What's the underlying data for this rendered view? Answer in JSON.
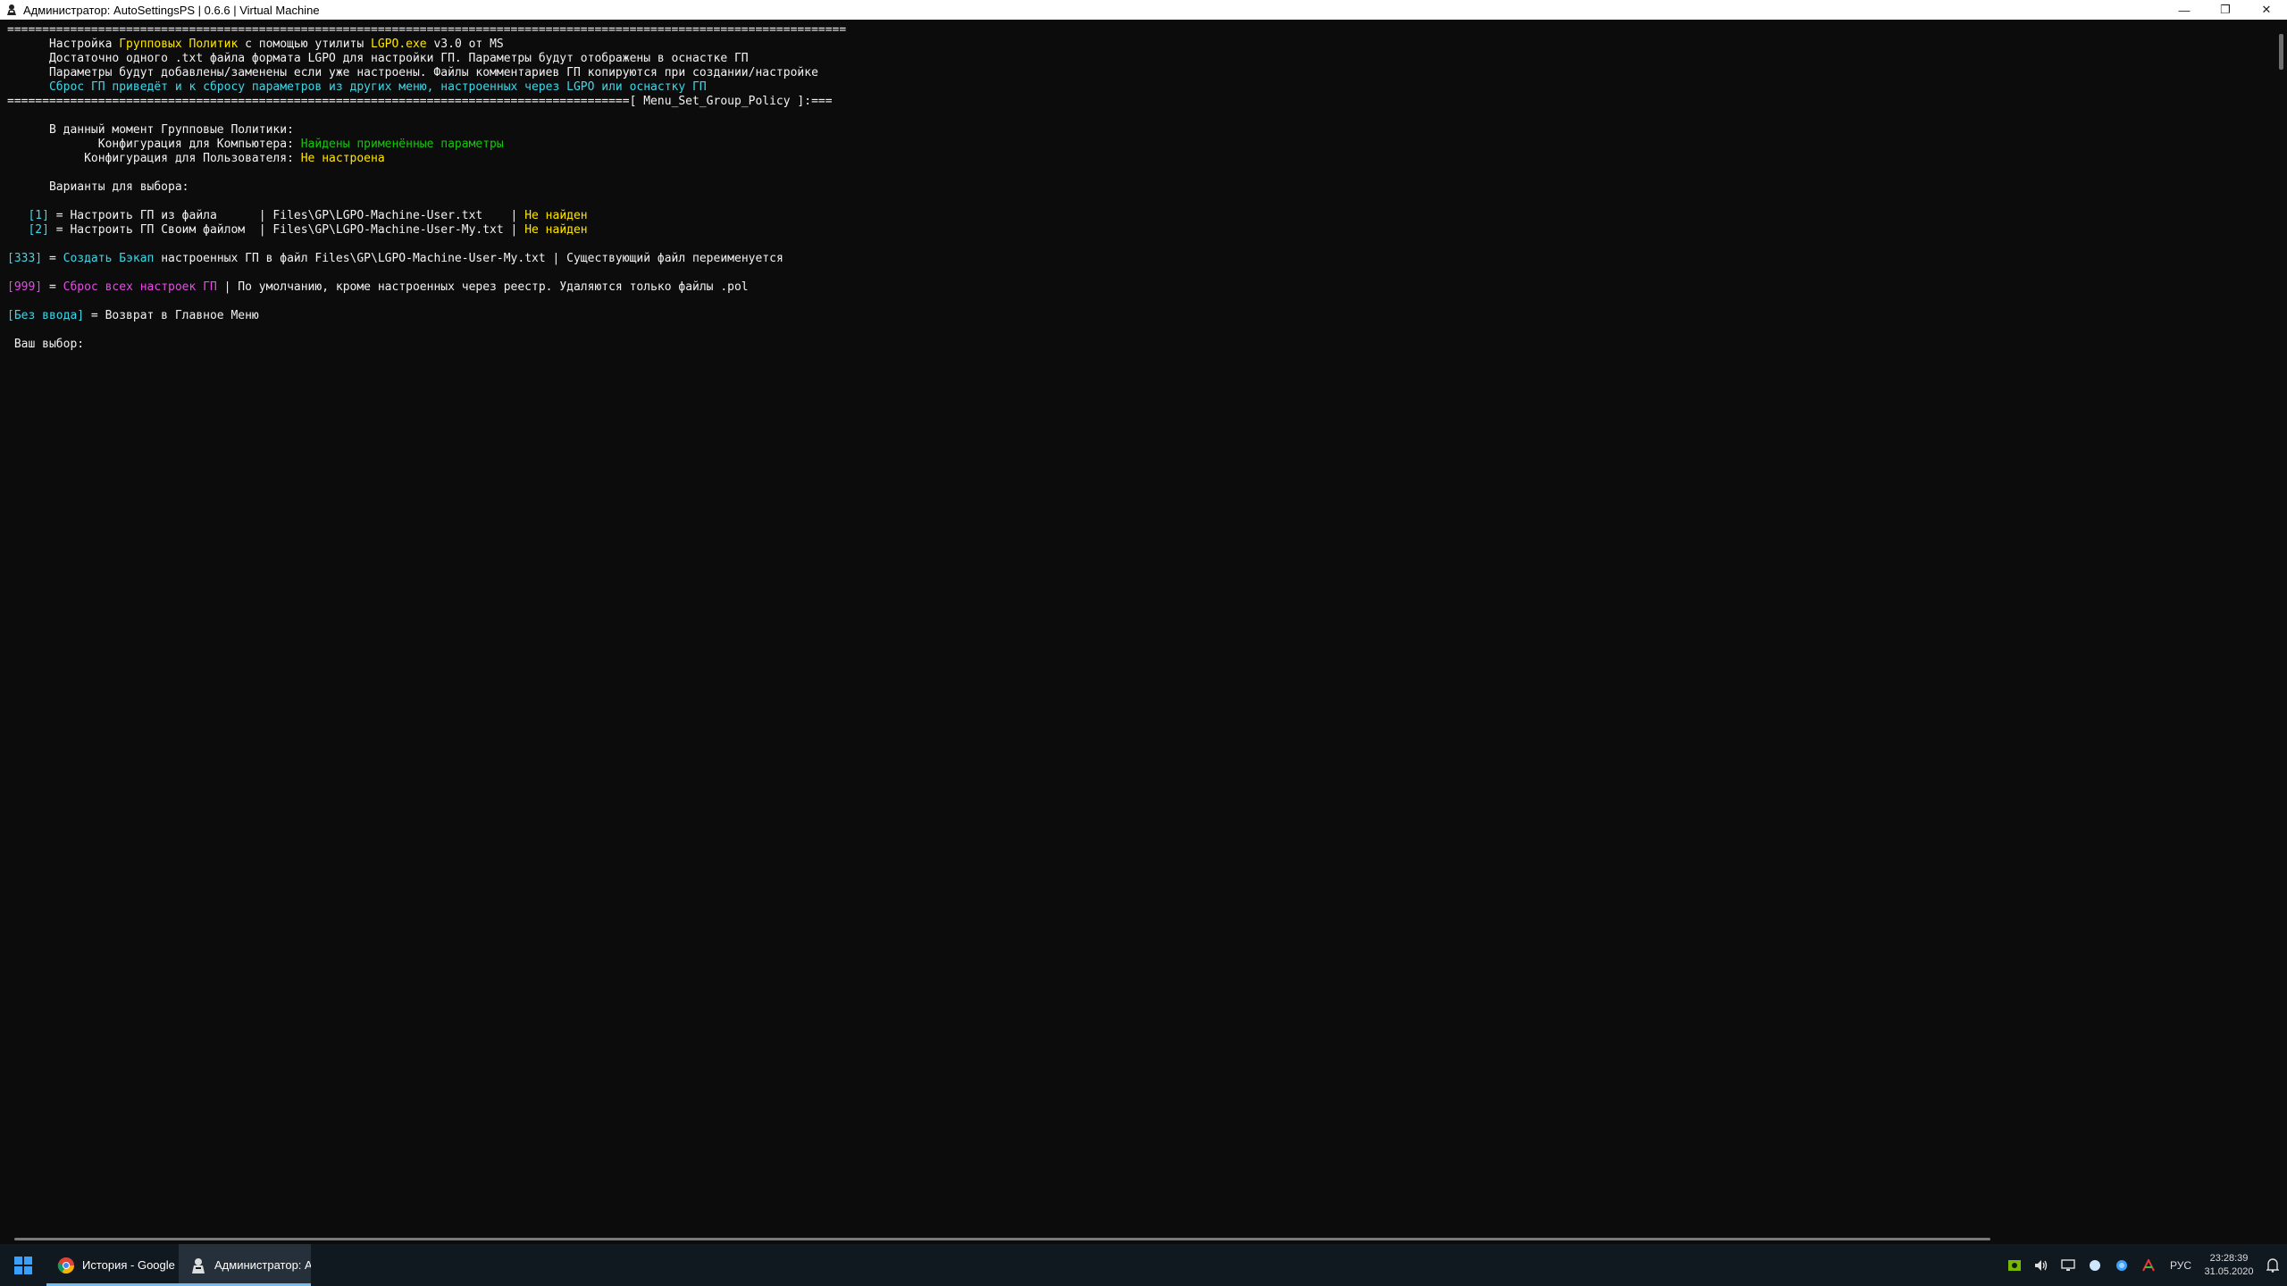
{
  "window": {
    "title": "Администратор: AutoSettingsPS | 0.6.6 | Virtual Machine",
    "minimize_glyph": "—",
    "restore_glyph": "❐",
    "close_glyph": "✕"
  },
  "console": {
    "sep_top": "========================================================================================================================",
    "intro1": {
      "a": "      Настройка ",
      "b": "Групповых Политик",
      "c": " с помощью утилиты ",
      "d": "LGPO.exe",
      "e": " v3.0 от MS"
    },
    "intro2": "      Достаточно одного .txt файла формата LGPO для настройки ГП. Параметры будут отображены в оснастке ГП",
    "intro3": "      Параметры будут добавлены/заменены если уже настроены. Файлы комментариев ГП копируются при создании/настройке",
    "intro4": "      Сброс ГП приведёт и к сбросу параметров из других меню, настроенных через LGPO или оснастку ГП",
    "sep_menu": "=========================================================================================[ Menu_Set_Group_Policy ]:===",
    "status_header": "      В данный момент Групповые Политики:",
    "status_pc": {
      "label": "             Конфигурация для Компьютера: ",
      "value": "Найдены применённые параметры"
    },
    "status_user": {
      "label": "           Конфигурация для Пользователя: ",
      "value": "Не настроена"
    },
    "options_header": "      Варианты для выбора:",
    "opt1": {
      "key": "   [1]",
      "text": " = Настроить ГП из файла      | Files\\GP\\LGPO-Machine-User.txt    | ",
      "state": "Не найден"
    },
    "opt2": {
      "key": "   [2]",
      "text": " = Настроить ГП Своим файлом  | Files\\GP\\LGPO-Machine-User-My.txt | ",
      "state": "Не найден"
    },
    "opt333": {
      "key": "[333]",
      "eq": " = ",
      "action": "Создать Бэкап",
      "text": " настроенных ГП в файл Files\\GP\\LGPO-Machine-User-My.txt | Существующий файл переименуется"
    },
    "opt999": {
      "key": "[999]",
      "eq": " = ",
      "action": "Сброс всех настроек ГП",
      "text": " | По умолчанию, кроме настроенных через реестр. Удаляются только файлы .pol"
    },
    "opt_none": {
      "key": "[Без ввода]",
      "text": " = Возврат в Главное Меню"
    },
    "prompt": " Ваш выбор:"
  },
  "taskbar": {
    "apps": [
      {
        "label": "История - Google ...",
        "icon": "chrome-icon"
      },
      {
        "label": "Администратор: A...",
        "icon": "terminal-app-icon"
      }
    ],
    "language": "РУС",
    "time": "23:28:39",
    "date": "31.05.2020"
  },
  "colors": {
    "console_bg": "#0c0c0c",
    "yellow": "#f9f1a5",
    "cyan": "#3fd6e8",
    "green": "#16c60c",
    "magenta": "#e34ce3",
    "taskbar_bg": "#101820",
    "accent": "#76b9ed"
  }
}
